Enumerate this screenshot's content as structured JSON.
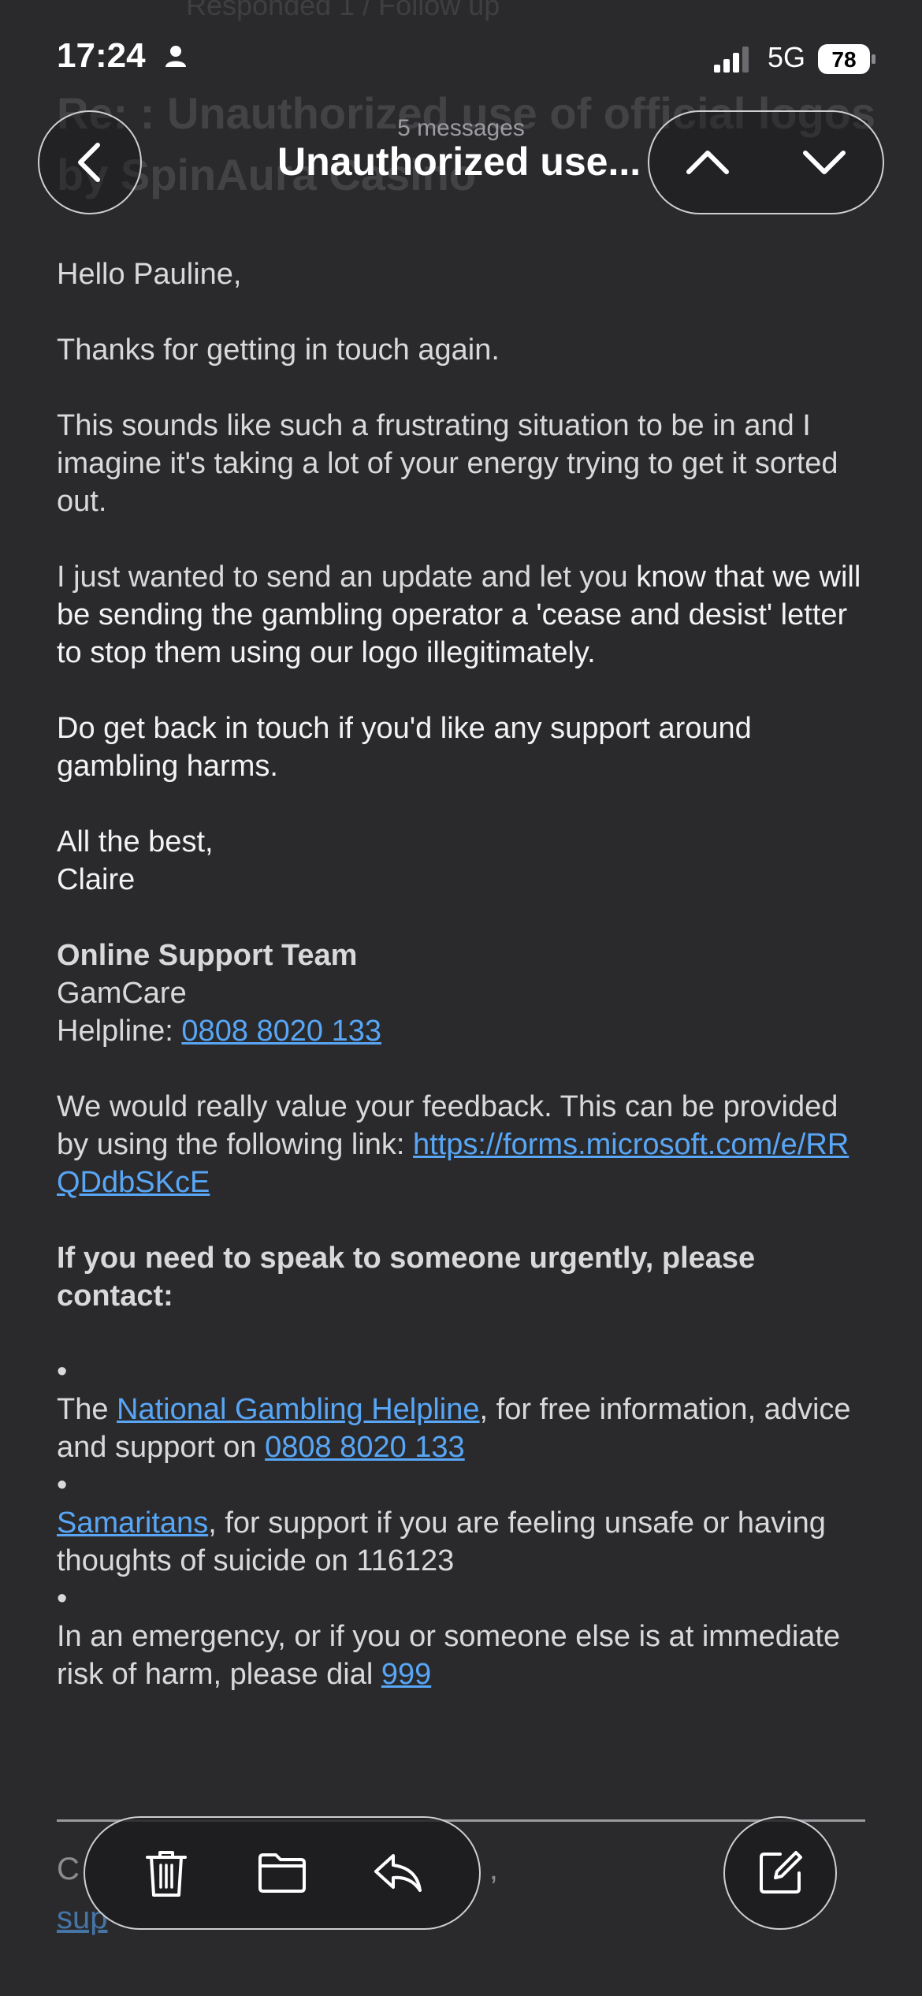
{
  "status_bar": {
    "time": "17:24",
    "network": "5G",
    "battery": "78"
  },
  "header": {
    "message_count": "5 messages",
    "title": "Unauthorized use...",
    "background_title": "Re: : Unauthorized use of official logos by SpinAura Casino",
    "background_top": "Responded 1 / Follow up"
  },
  "email": {
    "greeting": "Hello Pauline,",
    "line_thanks": "Thanks for getting in touch again.",
    "para_frustrating": "This sounds like such a frustrating situation to be in and I imagine it's taking a lot of your energy trying to get it sorted out.",
    "para_update_a": "I just wanted to send an update and let you ",
    "para_update_b": "know that we will be sending the gambling operator a 'cease and desist' letter to stop them using our logo illegitimately.",
    "para_support": "Do get back in touch if you'd like any support around gambling harms.",
    "signoff": "All the best,",
    "name": "Claire",
    "team": "Online Support Team",
    "org": "GamCare",
    "helpline_label": "Helpline: ",
    "helpline_number": "0808 8020 133",
    "feedback_text": "We would really value your feedback. This can be provided by using the following link: ",
    "feedback_link": "https://forms.microsoft.com/e/RRQDdbSKcE",
    "urgent_heading": "If you need to speak to someone urgently, please contact:",
    "bullet": "•",
    "ngh_prefix": "The ",
    "ngh_link": "National Gambling Helpline",
    "ngh_text": ", for free information, advice and support on ",
    "ngh_number": "0808 8020 133",
    "samaritans_link": "Samaritans",
    "samaritans_text": ", for support if you are feeling unsafe or having thoughts of suicide on 116123",
    "emergency_text": "In an emergency, or if you or someone else is at immediate risk of harm, please dial ",
    "emergency_number": "999",
    "footer_c": "C",
    "footer_comma": ",",
    "footer_sup": "sup"
  },
  "icons": {
    "back": "chevron-left-icon",
    "prev": "chevron-up-icon",
    "next": "chevron-down-icon",
    "trash": "trash-icon",
    "folder": "folder-icon",
    "reply": "reply-icon",
    "compose": "compose-icon"
  },
  "colors": {
    "background": "#2a2a2d",
    "link": "#58a6f5",
    "text": "#d9d9dc"
  }
}
